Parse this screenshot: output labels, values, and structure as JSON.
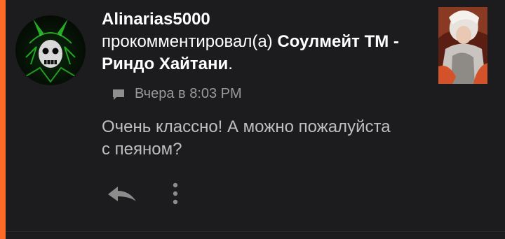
{
  "notification": {
    "username": "Alinarias5000",
    "action_text": "прокомментировал(а)",
    "story_title": "Соулмейт ТМ - Риндо Хайтани",
    "title_end": ".",
    "timestamp": "Вчера в 8:03 PM",
    "comment": "Очень классно! А можно пожалуйста с пеяном?",
    "icons": {
      "meta": "comment-icon",
      "reply": "reply-arrow-icon",
      "more": "more-vertical-icon"
    }
  },
  "colors": {
    "accent": "#ff6a28",
    "background": "#1c1b1d",
    "username": "#ffffff",
    "meta": "#9a9a9a",
    "comment": "#bfbfbf"
  }
}
